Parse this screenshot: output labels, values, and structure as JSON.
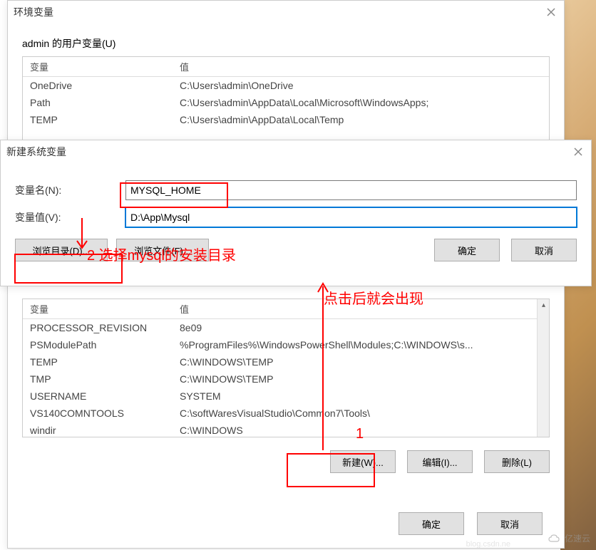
{
  "bg_dialog": {
    "title": "环境变量",
    "user_section_label": "admin 的用户变量(U)",
    "user_table": {
      "header_var": "变量",
      "header_val": "值",
      "rows": [
        {
          "name": "OneDrive",
          "value": "C:\\Users\\admin\\OneDrive"
        },
        {
          "name": "Path",
          "value": "C:\\Users\\admin\\AppData\\Local\\Microsoft\\WindowsApps;"
        },
        {
          "name": "TEMP",
          "value": "C:\\Users\\admin\\AppData\\Local\\Temp"
        }
      ]
    },
    "sys_table": {
      "header_var": "变量",
      "header_val": "值",
      "rows": [
        {
          "name": "PROCESSOR_REVISION",
          "value": "8e09"
        },
        {
          "name": "PSModulePath",
          "value": "%ProgramFiles%\\WindowsPowerShell\\Modules;C:\\WINDOWS\\s..."
        },
        {
          "name": "TEMP",
          "value": "C:\\WINDOWS\\TEMP"
        },
        {
          "name": "TMP",
          "value": "C:\\WINDOWS\\TEMP"
        },
        {
          "name": "USERNAME",
          "value": "SYSTEM"
        },
        {
          "name": "VS140COMNTOOLS",
          "value": "C:\\softWaresVisualStudio\\Common7\\Tools\\"
        },
        {
          "name": "windir",
          "value": "C:\\WINDOWS"
        }
      ]
    },
    "sys_buttons": {
      "new": "新建(W)...",
      "edit": "编辑(I)...",
      "delete": "删除(L)"
    },
    "dialog_buttons": {
      "ok": "确定",
      "cancel": "取消"
    }
  },
  "new_dialog": {
    "title": "新建系统变量",
    "name_label": "变量名(N):",
    "name_value": "MYSQL_HOME",
    "value_label": "变量值(V):",
    "value_value": "D:\\App\\Mysql",
    "browse_dir": "浏览目录(D)...",
    "browse_file": "浏览文件(F)...",
    "ok": "确定",
    "cancel": "取消"
  },
  "annotations": {
    "step1": "1",
    "step1_text": "点击后就会出现",
    "step2": "2 选择mysql的安装目录"
  },
  "watermark": {
    "text": "亿速云",
    "url": "blog.csdn.ne"
  }
}
